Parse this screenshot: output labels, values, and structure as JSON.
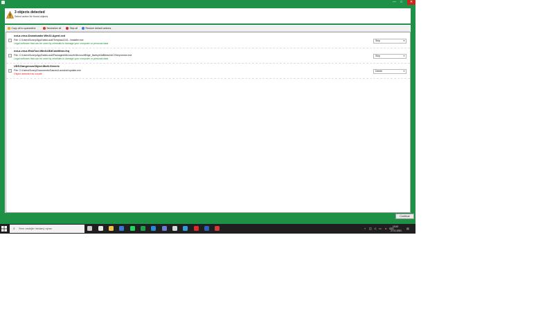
{
  "window": {
    "controls": {
      "minimize": "—",
      "maximize": "□",
      "close": "✕"
    }
  },
  "header": {
    "title": "3 objects detected",
    "subtitle": "Select action for found objects"
  },
  "toolbar": {
    "items": [
      {
        "label": "Copy all to quarantine",
        "icon": "quarantine-icon",
        "color": "#e8a21c"
      },
      {
        "label": "Neutralize all",
        "icon": "neutralize-icon",
        "color": "#e0342b"
      },
      {
        "label": "Skip all",
        "icon": "skip-icon",
        "color": "#d62a2a"
      },
      {
        "label": "Restore default actions",
        "icon": "restore-icon",
        "color": "#3b7bd6"
      }
    ]
  },
  "threats": [
    {
      "name": "not-a-virus:Downloader.Win32.Agent.xxd",
      "file": "File: C:\\Users\\Sunny\\AppData\\Local\\Temp\\aa1243...\\installer.exe",
      "description": "Legal software that can be used by criminals to damage your computer or personal data",
      "severity": "green",
      "action": "Skip"
    },
    {
      "name": "not-a-virus:RiskTool.Win64.BitCoinMiner.ihq",
      "file": "File: C:\\Users\\Sunny\\AppData\\Local\\Packages\\Microsoft.MicrosoftEdge_8wekyb3d8bbwe\\AC\\Temp\\miner.exe",
      "description": "Legal software that can be used by criminals to damage your computer or personal data",
      "severity": "green",
      "action": "Skip"
    },
    {
      "name": "UDS:DangerousObject.Multi.Generic",
      "file": "File: C:\\Users\\Sunny\\Documents\\Games\\Launcher\\update.exe",
      "description": "Object detected as unsafe",
      "severity": "red",
      "action": "Delete"
    }
  ],
  "footer": {
    "continue_label": "Continue"
  },
  "taskbar": {
    "search_placeholder": "Sem zadejte hledaný výraz",
    "time": "13:43",
    "date": "27.01.2021",
    "apps": [
      {
        "icon": "task-view-icon",
        "color": "#d0d0d0"
      },
      {
        "icon": "store-icon",
        "color": "#e8e8e8"
      },
      {
        "icon": "file-explorer-icon",
        "color": "#f2c14e"
      },
      {
        "icon": "todo-icon",
        "color": "#3a78d8"
      },
      {
        "icon": "spotify-icon",
        "color": "#1ed760"
      },
      {
        "icon": "xbox-icon",
        "color": "#1aa34a"
      },
      {
        "icon": "mail-icon",
        "color": "#2b88d8"
      },
      {
        "icon": "calendar-icon",
        "color": "#6b7bd6"
      },
      {
        "icon": "cloud-icon",
        "color": "#d8d8d8"
      },
      {
        "icon": "edge-icon",
        "color": "#2f9fd8"
      },
      {
        "icon": "opera-icon",
        "color": "#e0282e"
      },
      {
        "icon": "word-icon",
        "color": "#2b5fb8"
      },
      {
        "icon": "kaspersky-icon",
        "color": "#d33a3a"
      }
    ]
  },
  "colors": {
    "accent": "#1e9146",
    "warning": "#e8a21c",
    "danger": "#e11b1b",
    "safe": "#1f8c2f"
  }
}
